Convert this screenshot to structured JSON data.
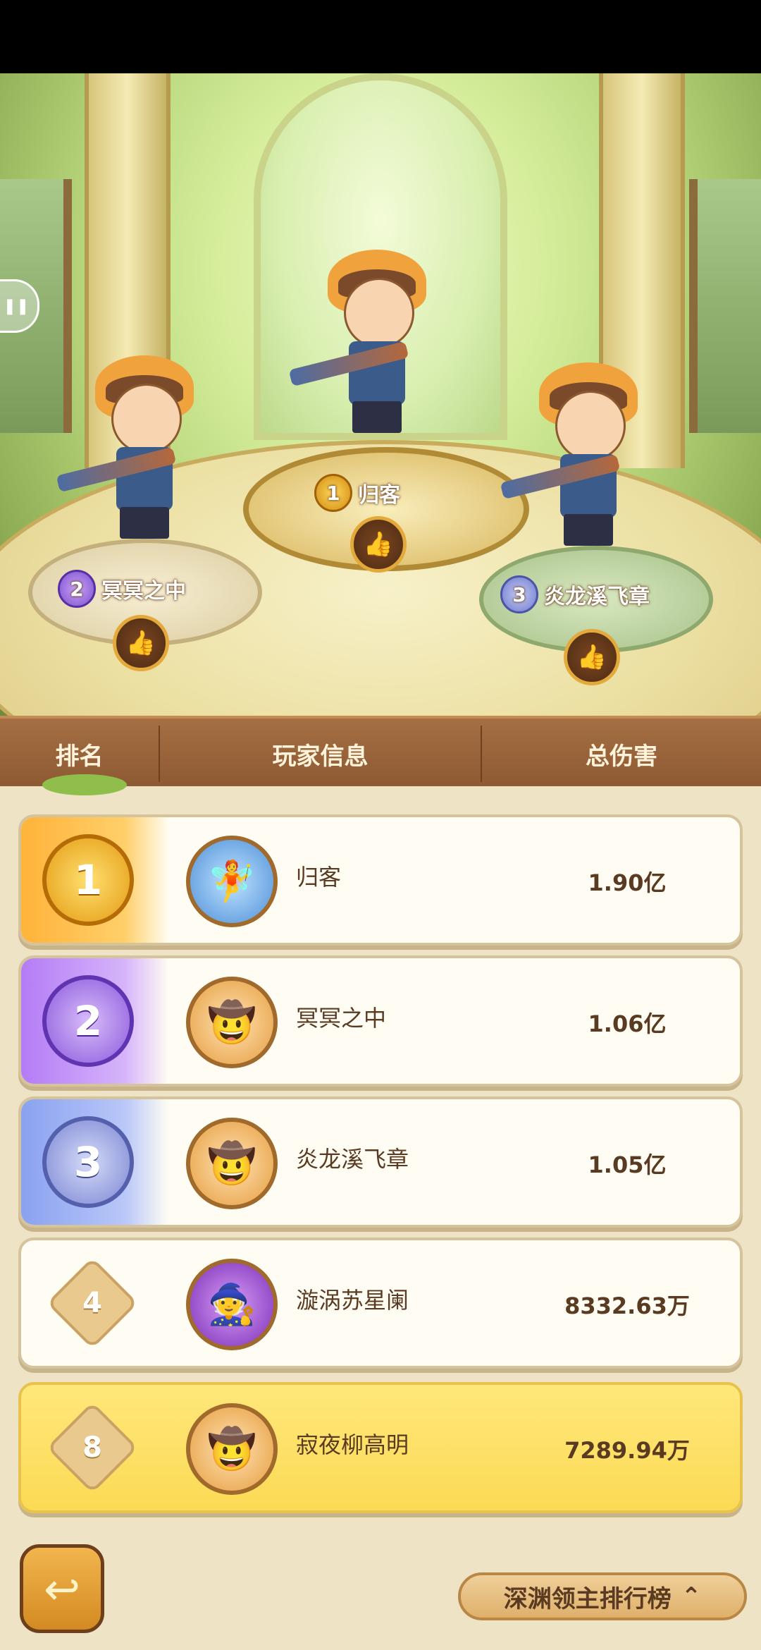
{
  "podium": [
    {
      "rank": "1",
      "name": "归客"
    },
    {
      "rank": "2",
      "name": "冥冥之中"
    },
    {
      "rank": "3",
      "name": "炎龙溪飞章"
    }
  ],
  "table_header": {
    "rank": "排名",
    "player_info": "玩家信息",
    "total_damage": "总伤害"
  },
  "rows": [
    {
      "rank": "1",
      "name": "归客",
      "damage": "1.90亿",
      "avatar": "blue-spirit-avatar"
    },
    {
      "rank": "2",
      "name": "冥冥之中",
      "damage": "1.06亿",
      "avatar": "farmer-avatar"
    },
    {
      "rank": "3",
      "name": "炎龙溪飞章",
      "damage": "1.05亿",
      "avatar": "farmer-avatar"
    },
    {
      "rank": "4",
      "name": "漩涡苏星阑",
      "damage": "8332.63万",
      "avatar": "witch-avatar"
    },
    {
      "rank": "8",
      "name": "寂夜柳高明",
      "damage": "7289.94万",
      "avatar": "farmer-avatar"
    }
  ],
  "bottom": {
    "leaderboard_label": "深渊领主排行榜"
  },
  "icons": {
    "like": "thumbs-up-icon",
    "back": "back-arrow-icon",
    "expand": "chevron-up-icon",
    "pause": "pause-icon"
  },
  "colors": {
    "gold": "#e49a12",
    "purple": "#8c58dd",
    "blue": "#7b86d3",
    "header_brown": "#8d5932",
    "highlight": "#fbda55"
  }
}
